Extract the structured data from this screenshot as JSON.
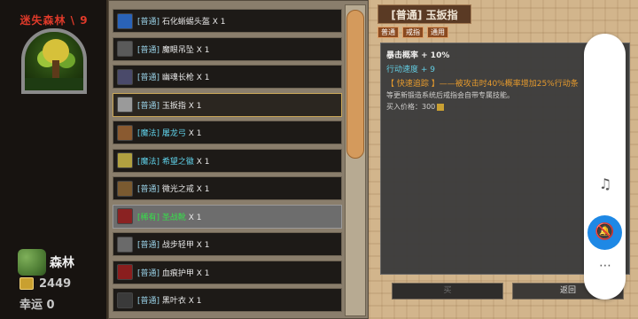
{
  "left": {
    "area_title": "迷失森林 \\ 9",
    "region_name": "森林",
    "gold": "2449",
    "luck": "幸运 0"
  },
  "items": [
    {
      "quality": "[普通]",
      "name": "石化蜥蜴头盔",
      "count": "X 1",
      "class": "q-common",
      "icon_color": "#2a63b8"
    },
    {
      "quality": "[普通]",
      "name": "魔眼吊坠",
      "count": "X 1",
      "class": "q-common",
      "icon_color": "#5a5a5a"
    },
    {
      "quality": "[普通]",
      "name": "幽魂长枪",
      "count": "X 1",
      "class": "q-common",
      "icon_color": "#4a4a6a"
    },
    {
      "quality": "[普通]",
      "name": "玉扳指",
      "count": "X 1",
      "class": "q-common",
      "icon_color": "#9a9a9a"
    },
    {
      "quality": "[魔法]",
      "name": "屠龙弓",
      "count": "X 1",
      "class": "q-magic",
      "icon_color": "#8a5a30"
    },
    {
      "quality": "[魔法]",
      "name": "希望之徽",
      "count": "X 1",
      "class": "q-magic",
      "icon_color": "#b0a040"
    },
    {
      "quality": "[普通]",
      "name": "微光之戒",
      "count": "X 1",
      "class": "q-common",
      "icon_color": "#7a5a30"
    },
    {
      "quality": "[稀有]",
      "name": "圣战靴",
      "count": "X 1",
      "class": "q-rare",
      "icon_color": "#8a2222"
    },
    {
      "quality": "[普通]",
      "name": "战步轻甲",
      "count": "X 1",
      "class": "q-common",
      "icon_color": "#6a6a6a"
    },
    {
      "quality": "[普通]",
      "name": "血痕护甲",
      "count": "X 1",
      "class": "q-common",
      "icon_color": "#8a1e1e"
    },
    {
      "quality": "[普通]",
      "name": "黑叶衣",
      "count": "X 1",
      "class": "q-common",
      "icon_color": "#3a3a3a"
    }
  ],
  "detail": {
    "title": "[普通] 玉扳指",
    "tags": [
      "普通",
      "戒指",
      "通用"
    ],
    "stat1": "暴击概率 + 10%",
    "stat2": "行动速度 + 9",
    "skill": "【 快速追踪 】——被攻击时40%概率增加25%行动条",
    "note": "等更新锻造系统后戒指会自带专属技能。",
    "price_label": "买入价格：",
    "price": "300",
    "buy": "买",
    "back": "返回"
  },
  "colors": {
    "accent_orange": "#e89a2a",
    "rare_green": "#36e04a",
    "magic_cyan": "#5fd0e8",
    "title_red": "#e03a2a"
  },
  "float_bar": {
    "icons": [
      "music-off-icon",
      "bell-off-icon",
      "more-icon"
    ]
  }
}
